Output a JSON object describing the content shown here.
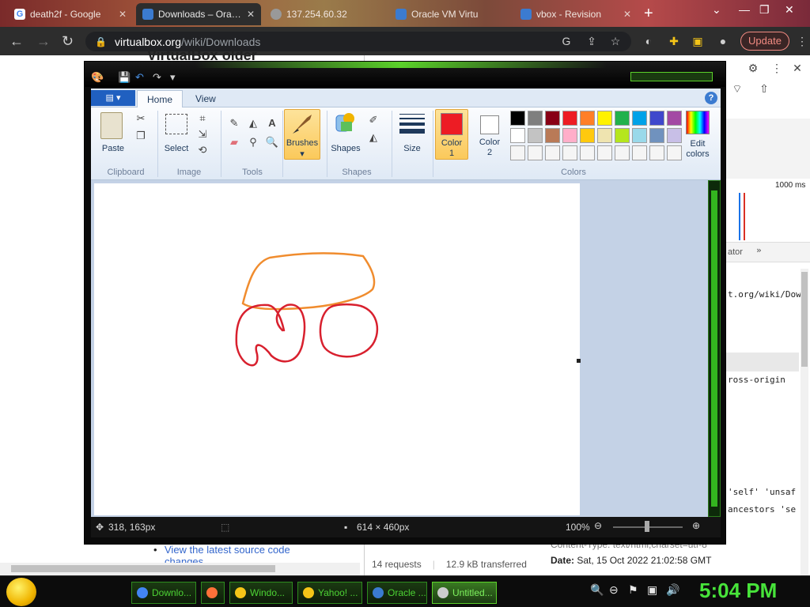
{
  "browser": {
    "tabs": [
      {
        "title": "death2f - Google"
      },
      {
        "title": "Downloads – Oracle"
      },
      {
        "title": "137.254.60.32"
      },
      {
        "title": "Oracle VM Virtu"
      },
      {
        "title": "vbox - Revision"
      }
    ],
    "url_domain": "virtualbox.org",
    "url_path": "/wiki/Downloads",
    "update_label": "Update"
  },
  "page": {
    "heading": "VirtualBox older",
    "link_line1": "View the latest source code",
    "link_line2": "changes"
  },
  "devtools": {
    "timeline_label": "1000 ms",
    "tab_label": "ator",
    "url_fragment": "t.org/wiki/Dow",
    "cross_origin": "ross-origin",
    "csp_line1": "'self' 'unsaf",
    "csp_line2": "ancestors 'se",
    "requests": "14 requests",
    "transferred": "12.9 kB transferred",
    "content_type": "Content-Type: text/html;charset=utf-8",
    "date_label": "Date:",
    "date_value": "Sat, 15 Oct 2022 21:02:58 GMT"
  },
  "paint": {
    "tabs": {
      "home": "Home",
      "view": "View"
    },
    "clipboard": {
      "paste": "Paste",
      "label": "Clipboard"
    },
    "image": {
      "select": "Select",
      "label": "Image"
    },
    "tools": {
      "label": "Tools"
    },
    "brushes": {
      "label": "Brushes"
    },
    "shapes": {
      "shapes": "Shapes",
      "label": "Shapes"
    },
    "size": {
      "label": "Size"
    },
    "colors": {
      "color1_a": "Color",
      "color1_b": "1",
      "color2_a": "Color",
      "color2_b": "2",
      "edit_a": "Edit",
      "edit_b": "colors",
      "label": "Colors",
      "color1_hex": "#ed1c24",
      "palette_row1": [
        "#000000",
        "#7f7f7f",
        "#880015",
        "#ed1c24",
        "#ff7f27",
        "#fff200",
        "#22b14c",
        "#00a2e8",
        "#3f48cc",
        "#a349a4"
      ],
      "palette_row2": [
        "#ffffff",
        "#c3c3c3",
        "#b97a57",
        "#ffaec9",
        "#ffc90e",
        "#efe4b0",
        "#b5e61d",
        "#99d9ea",
        "#7092be",
        "#c8bfe7"
      ]
    },
    "status": {
      "cursor": "318, 163px",
      "dimensions": "614 × 460px",
      "zoom": "100%"
    },
    "drawing": {
      "stroke_colors": {
        "top_shape": "#f08c2e",
        "bottom_shapes": "#d8202e"
      }
    }
  },
  "taskbar": {
    "tasks": [
      {
        "label": "Downlo...",
        "color": "#4285f4"
      },
      {
        "label": "",
        "color": "#ff7139"
      },
      {
        "label": "Windo...",
        "color": "#f5c518"
      },
      {
        "label": "Yahoo! ...",
        "color": "#f5c518"
      },
      {
        "label": "Oracle ...",
        "color": "#3b7bd0"
      },
      {
        "label": "Untitled...",
        "color": "#cccccc"
      }
    ],
    "clock": "5:04 PM"
  }
}
